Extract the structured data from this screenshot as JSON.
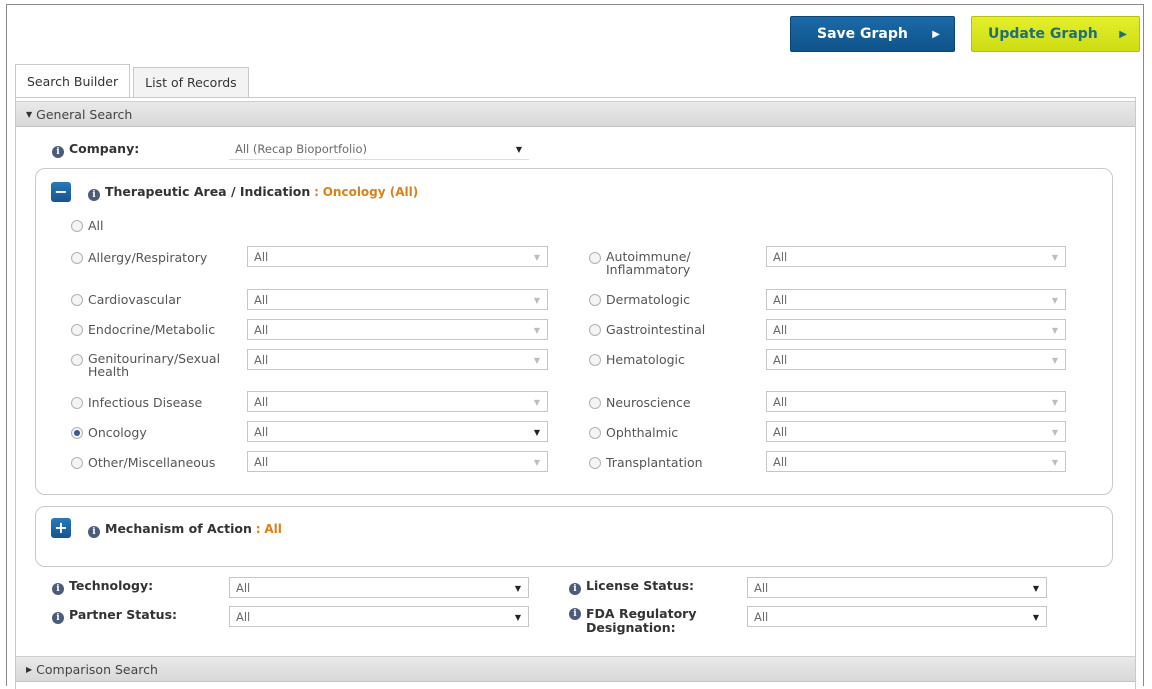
{
  "header": {
    "save_label": "Save Graph",
    "update_label": "Update Graph"
  },
  "tabs": [
    {
      "label": "Search Builder",
      "active": true
    },
    {
      "label": "List of Records",
      "active": false
    }
  ],
  "general_search": {
    "title": "General Search",
    "company": {
      "label": "Company:",
      "value": "All (Recap Bioportfolio)"
    },
    "therapeutic": {
      "label": "Therapeutic Area / Indication",
      "separator": ":",
      "value": "Oncology (All)",
      "all_label": "All",
      "rows": [
        {
          "left": {
            "label": "Allergy/Respiratory",
            "value": "All"
          },
          "right": {
            "label": "Autoimmune/ Inflammatory",
            "value": "All"
          }
        },
        {
          "left": {
            "label": "Cardiovascular",
            "value": "All"
          },
          "right": {
            "label": "Dermatologic",
            "value": "All"
          }
        },
        {
          "left": {
            "label": "Endocrine/Metabolic",
            "value": "All"
          },
          "right": {
            "label": "Gastrointestinal",
            "value": "All"
          }
        },
        {
          "left": {
            "label": "Genitourinary/Sexual Health",
            "value": "All"
          },
          "right": {
            "label": "Hematologic",
            "value": "All"
          }
        },
        {
          "left": {
            "label": "Infectious Disease",
            "value": "All"
          },
          "right": {
            "label": "Neuroscience",
            "value": "All"
          }
        },
        {
          "left": {
            "label": "Oncology",
            "value": "All",
            "checked": true
          },
          "right": {
            "label": "Ophthalmic",
            "value": "All"
          }
        },
        {
          "left": {
            "label": "Other/Miscellaneous",
            "value": "All"
          },
          "right": {
            "label": "Transplantation",
            "value": "All"
          }
        }
      ]
    },
    "moa": {
      "label": "Mechanism of Action",
      "separator": ":",
      "value": "All"
    },
    "technology": {
      "label": "Technology:",
      "value": "All"
    },
    "partner_status": {
      "label": "Partner Status:",
      "value": "All"
    },
    "license_status": {
      "label": "License Status:",
      "value": "All"
    },
    "fda": {
      "label": "FDA Regulatory Designation:",
      "value": "All"
    }
  },
  "comparison_search": {
    "title": "Comparison Search"
  },
  "colors": {
    "save_bg": "#1263a0",
    "update_bg": "#d6e41c",
    "accent_orange": "#d9821a"
  }
}
